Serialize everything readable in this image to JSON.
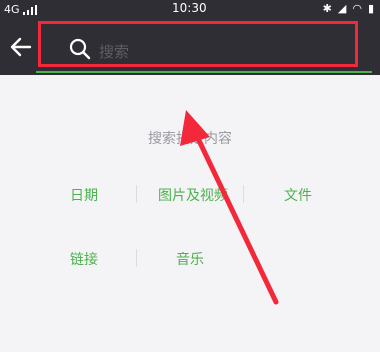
{
  "status_bar": {
    "network": "4G",
    "time": "10:30"
  },
  "nav": {
    "search_placeholder": "搜索"
  },
  "main": {
    "hint": "搜索指定内容",
    "categories": [
      "日期",
      "图片及视频",
      "文件",
      "链接",
      "音乐"
    ]
  },
  "colors": {
    "accent": "#4cb14e",
    "annotation": "#f3283a",
    "nav_bg": "#2e2e34"
  }
}
